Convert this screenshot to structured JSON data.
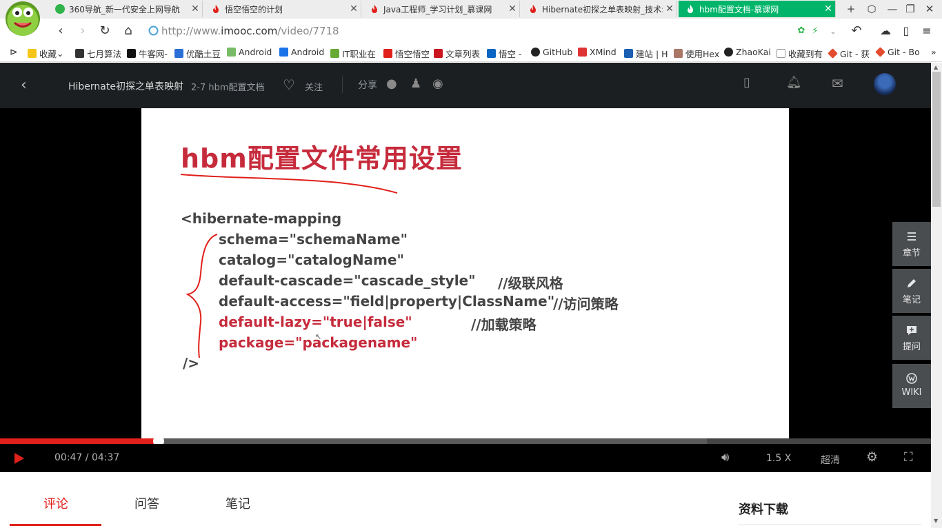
{
  "browser": {
    "tabs": [
      {
        "title": "360导航_新一代安全上网导航",
        "active": false
      },
      {
        "title": "悟空悟空的计划",
        "active": false
      },
      {
        "title": "Java工程师_学习计划_慕课网",
        "active": false
      },
      {
        "title": "Hibernate初探之单表映射_技术:",
        "active": false
      },
      {
        "title": "hbm配置文档-慕课网",
        "active": true
      }
    ],
    "url_prefix": "http://www.",
    "url_domain": "imooc.com",
    "url_path": "/video/7718",
    "bookmarks": [
      "收藏",
      "七月算法",
      "牛客网-",
      "优酷土豆",
      "Android",
      "Android",
      "IT职业在",
      "悟空悟空",
      "文章列表",
      "悟空 -",
      "GitHub",
      "XMind",
      "建站 | H",
      "使用Hex",
      "ZhaoKai",
      "收藏到有",
      "Git - 获",
      "Git - Bo"
    ]
  },
  "header": {
    "course_title": "Hibernate初探之单表映射",
    "lesson": "2-7 hbm配置文档",
    "follow": "关注",
    "share": "分享"
  },
  "slide": {
    "title": "hbm配置文件常用设置",
    "lines": [
      {
        "text": "<hibernate-mapping",
        "comment": ""
      },
      {
        "text": "schema=\"schemaName\"",
        "comment": ""
      },
      {
        "text": "catalog=\"catalogName\"",
        "comment": ""
      },
      {
        "text": "default-cascade=\"cascade_style\"",
        "comment": "//级联风格"
      },
      {
        "text": "default-access=\"field|property|ClassName\"",
        "comment": "//访问策略"
      },
      {
        "text": "default-lazy=\"true|false\"",
        "comment": "//加载策略"
      },
      {
        "text": "package=\"packagename\"",
        "comment": ""
      },
      {
        "text": "/>",
        "comment": ""
      }
    ]
  },
  "player": {
    "current_time": "00:47",
    "total_time": "04:37",
    "time_separator": " / ",
    "progress": 0.171,
    "buffered": 0.759,
    "speed": "1.5 X",
    "quality": "超清"
  },
  "rail": [
    {
      "label": "章节",
      "icon": "menu-icon"
    },
    {
      "label": "笔记",
      "icon": "pencil-icon"
    },
    {
      "label": "提问",
      "icon": "question-icon"
    },
    {
      "label": "WIKI",
      "icon": "wiki-icon"
    }
  ],
  "bottom": {
    "tabs": [
      "评论",
      "问答",
      "笔记"
    ],
    "downloads": "资料下载"
  },
  "colors": {
    "accent": "#00b56a",
    "red": "#e0201a",
    "slide_red": "#c62b3c"
  }
}
